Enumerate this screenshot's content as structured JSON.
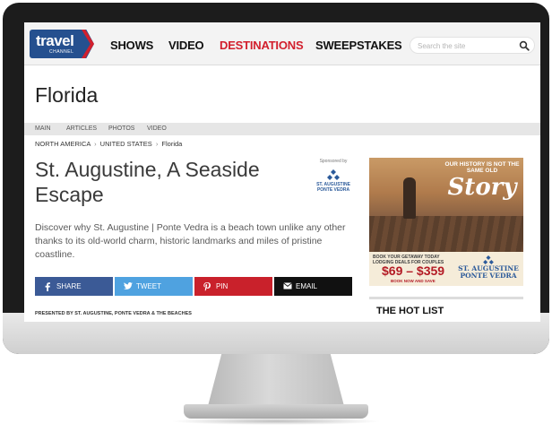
{
  "site": {
    "logo_text": "travel",
    "logo_subtext": "CHANNEL",
    "nav": [
      "SHOWS",
      "VIDEO",
      "DESTINATIONS",
      "SWEEPSTAKES"
    ],
    "active_nav": "DESTINATIONS",
    "search_placeholder": "Search the site"
  },
  "page": {
    "title": "Florida",
    "subnav": [
      "MAIN",
      "ARTICLES",
      "PHOTOS",
      "VIDEO"
    ],
    "breadcrumb": [
      "NORTH AMERICA",
      "UNITED STATES",
      "Florida"
    ]
  },
  "article": {
    "title": "St. Augustine, A Seaside Escape",
    "description": "Discover why St. Augustine | Ponte Vedra is a beach town unlike any other thanks to its old-world charm, historic landmarks and miles of pristine coastline.",
    "sponsor_label": "Sponsored by",
    "sponsor_name": "ST. AUGUSTINE PONTE VEDRA",
    "presented_by": "PRESENTED BY ST. AUGUSTINE, PONTE VEDRA & THE BEACHES"
  },
  "share": {
    "facebook": "SHARE",
    "twitter": "TWEET",
    "pinterest": "PIN",
    "email": "EMAIL"
  },
  "ad": {
    "headline": "OUR HISTORY IS NOT THE SAME OLD",
    "story": "Story",
    "book_text": "BOOK YOUR GETAWAY TODAY LODGING DEALS FOR COUPLES",
    "price": "$69 – $359",
    "book_now": "BOOK NOW AND SAVE",
    "brand": "ST. AUGUSTINE PONTE VEDRA"
  },
  "sidebar": {
    "hot_list_title": "THE HOT LIST"
  },
  "colors": {
    "brand_blue": "#25508f",
    "brand_red": "#d21f2d",
    "facebook": "#3b5a96",
    "twitter": "#4fa2e0",
    "pinterest": "#c9212b",
    "email": "#111111"
  }
}
